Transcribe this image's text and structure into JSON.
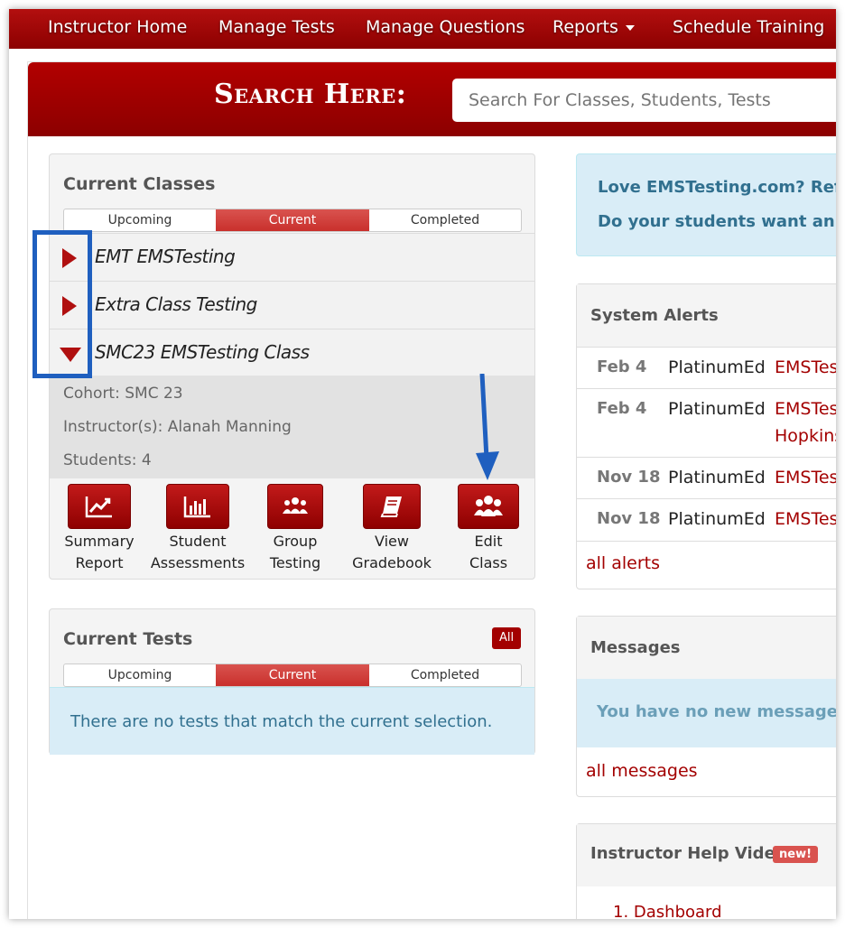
{
  "nav": {
    "items": [
      "Instructor Home",
      "Manage Tests",
      "Manage Questions",
      "Reports",
      "Schedule Training"
    ]
  },
  "search": {
    "label": "Search Here:",
    "placeholder": "Search For Classes, Students, Tests"
  },
  "current_classes": {
    "title": "Current Classes",
    "tabs": [
      "Upcoming",
      "Current",
      "Completed"
    ],
    "active_tab": "Current",
    "classes": [
      {
        "name": "EMT EMSTesting",
        "expanded": false
      },
      {
        "name": "Extra Class Testing",
        "expanded": false
      },
      {
        "name": "SMC23 EMSTesting Class",
        "expanded": true
      }
    ],
    "details": {
      "cohort": "Cohort: SMC 23",
      "instructors": "Instructor(s): Alanah Manning",
      "students": "Students: 4"
    },
    "actions": [
      {
        "line1": "Summary",
        "line2": "Report",
        "icon": "line-chart-icon"
      },
      {
        "line1": "Student",
        "line2": "Assessments",
        "icon": "bar-chart-icon"
      },
      {
        "line1": "Group",
        "line2": "Testing",
        "icon": "group-icon"
      },
      {
        "line1": "View",
        "line2": "Gradebook",
        "icon": "book-icon"
      },
      {
        "line1": "Edit",
        "line2": "Class",
        "icon": "users-icon"
      }
    ]
  },
  "current_tests": {
    "title": "Current Tests",
    "all_badge": "All",
    "tabs": [
      "Upcoming",
      "Current",
      "Completed"
    ],
    "active_tab": "Current",
    "empty_message": "There are no tests that match the current selection."
  },
  "referral": {
    "line1": "Love EMSTesting.com? Refer",
    "line2": "Do your students want an EM"
  },
  "system_alerts": {
    "title": "System Alerts",
    "rows": [
      {
        "date": "Feb 4",
        "source": "PlatinumEd",
        "link": "EMSTest",
        "extra": ""
      },
      {
        "date": "Feb 4",
        "source": "PlatinumEd",
        "link": "EMSTest",
        "extra": "Hopkins"
      },
      {
        "date": "Nov 18",
        "source": "PlatinumEd",
        "link": "EMSTest",
        "extra": ""
      },
      {
        "date": "Nov 18",
        "source": "PlatinumEd",
        "link": "EMSTest",
        "extra": ""
      }
    ],
    "all_link": "all alerts"
  },
  "messages": {
    "title": "Messages",
    "empty": "You have no new messages.",
    "all_link": "all messages"
  },
  "help_videos": {
    "title": "Instructor Help Videos",
    "badge": "new!",
    "items": [
      "1. Dashboard"
    ]
  },
  "colors": {
    "brand_red": "#a30000",
    "highlight_blue": "#1f5fbf",
    "info_bg": "#d9edf7"
  }
}
